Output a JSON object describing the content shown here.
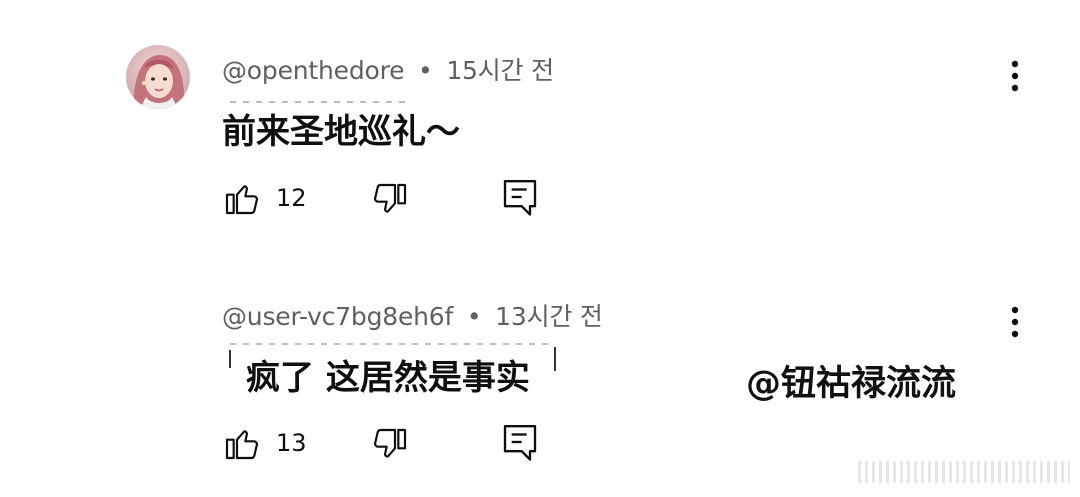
{
  "comments": [
    {
      "handle": "@openthedore",
      "separator": "•",
      "time": "15시간 전",
      "text": "前来圣地巡礼～",
      "likes": "12",
      "has_avatar": true
    },
    {
      "handle": "@user-vc7bg8eh6f",
      "separator": "•",
      "time": "13시간 전",
      "text": "疯了 这居然是事实",
      "likes": "13",
      "has_avatar": false
    }
  ],
  "watermark": "@钮祜禄流流",
  "icons": {
    "like": "thumbs-up-icon",
    "dislike": "thumbs-down-icon",
    "reply": "reply-comment-icon",
    "more": "more-vertical-icon"
  },
  "colors": {
    "text": "#0f0f0f",
    "meta": "#606060",
    "background": "#ffffff"
  }
}
